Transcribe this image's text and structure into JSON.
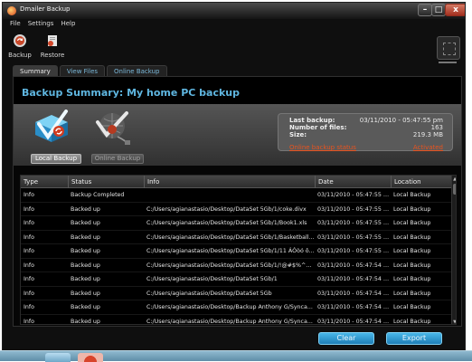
{
  "window": {
    "title": "Dmailer Backup",
    "controls": {
      "minimize": "–",
      "maximize": "□",
      "close": "x"
    }
  },
  "menu": [
    "File",
    "Settings",
    "Help"
  ],
  "toolbar": {
    "backup_label": "Backup",
    "restore_label": "Restore"
  },
  "tabs": [
    {
      "label": "Summary",
      "active": true
    },
    {
      "label": "View Files",
      "active": false
    },
    {
      "label": "Online Backup",
      "active": false
    }
  ],
  "summary": {
    "title": "Backup Summary: My home PC backup",
    "local_backup_label": "Local Backup",
    "online_backup_label": "Online Backup",
    "stats": {
      "last_backup_label": "Last backup:",
      "last_backup_value": "03/11/2010 - 05:47:55 pm",
      "files_label": "Number of files:",
      "files_value": "163",
      "size_label": "Size:",
      "size_value": "219.3 MB",
      "online_status_label": "Online backup status",
      "online_status_value": "Activated"
    }
  },
  "table": {
    "columns": [
      "Type",
      "Status",
      "Info",
      "Date",
      "Location"
    ],
    "rows": [
      [
        "Info",
        "Backup Completed",
        "",
        "03/11/2010 - 05:47:55 pm",
        "Local Backup"
      ],
      [
        "Info",
        "Backed up",
        "C:/Users/agianastasio/Desktop/DataSet 5Gb/1/coke.divx",
        "03/11/2010 - 05:47:55 pm",
        "Local Backup"
      ],
      [
        "Info",
        "Backed up",
        "C:/Users/agianastasio/Desktop/DataSet 5Gb/1/Book1.xls",
        "03/11/2010 - 05:47:55 pm",
        "Local Backup"
      ],
      [
        "Info",
        "Backed up",
        "C:/Users/agianastasio/Desktop/DataSet 5Gb/1/Basketball...",
        "03/11/2010 - 05:47:55 pm",
        "Local Backup"
      ],
      [
        "Info",
        "Backed up",
        "C:/Users/agianastasio/Desktop/DataSet 5Gb/1/11 ÁÓòó ô...",
        "03/11/2010 - 05:47:55 pm",
        "Local Backup"
      ],
      [
        "Info",
        "Backed up",
        "C:/Users/agianastasio/Desktop/DataSet 5Gb/1/!@#$%^&()...",
        "03/11/2010 - 05:47:54 pm",
        "Local Backup"
      ],
      [
        "Info",
        "Backed up",
        "C:/Users/agianastasio/Desktop/DataSet 5Gb/1",
        "03/11/2010 - 05:47:54 pm",
        "Local Backup"
      ],
      [
        "Info",
        "Backed up",
        "C:/Users/agianastasio/Desktop/DataSet 5Gb",
        "03/11/2010 - 05:47:54 pm",
        "Local Backup"
      ],
      [
        "Info",
        "Backed up",
        "C:/Users/agianastasio/Desktop/Backup Anthony G/Synca...",
        "03/11/2010 - 05:47:54 pm",
        "Local Backup"
      ],
      [
        "Info",
        "Backed up",
        "C:/Users/agianastasio/Desktop/Backup Anthony G/Synca...",
        "03/11/2010 - 05:47:54 pm",
        "Local Backup"
      ]
    ]
  },
  "actions": {
    "clear_label": "Clear",
    "export_label": "Export"
  },
  "colors": {
    "accent_blue": "#5fb6e0",
    "link_orange": "#e8531f",
    "button_blue": "#2f9bd3"
  }
}
